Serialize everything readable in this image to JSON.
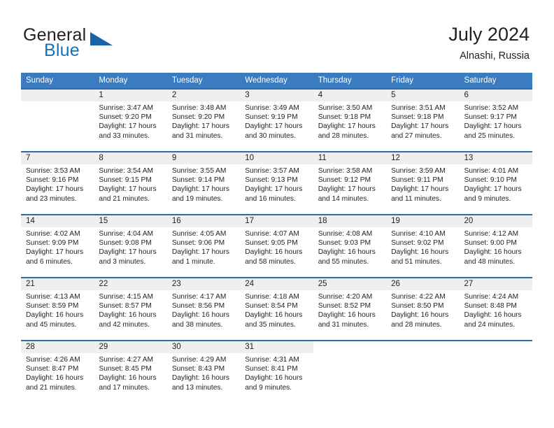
{
  "brand": {
    "word_one": "General",
    "word_two": "Blue",
    "accent_color": "#1573bb",
    "triangle_color": "#1565a8"
  },
  "header": {
    "title": "July 2024",
    "subtitle": "Alnashi, Russia",
    "header_bg": "#3a7cbf",
    "week_rule_color": "#2c6cae",
    "daynum_band_color": "#efefef"
  },
  "weekday_headers": [
    "Sunday",
    "Monday",
    "Tuesday",
    "Wednesday",
    "Thursday",
    "Friday",
    "Saturday"
  ],
  "weeks": [
    [
      {
        "day": "",
        "empty": true
      },
      {
        "day": "1",
        "sunrise": "Sunrise: 3:47 AM",
        "sunset": "Sunset: 9:20 PM",
        "daylight": "Daylight: 17 hours and 33 minutes."
      },
      {
        "day": "2",
        "sunrise": "Sunrise: 3:48 AM",
        "sunset": "Sunset: 9:20 PM",
        "daylight": "Daylight: 17 hours and 31 minutes."
      },
      {
        "day": "3",
        "sunrise": "Sunrise: 3:49 AM",
        "sunset": "Sunset: 9:19 PM",
        "daylight": "Daylight: 17 hours and 30 minutes."
      },
      {
        "day": "4",
        "sunrise": "Sunrise: 3:50 AM",
        "sunset": "Sunset: 9:18 PM",
        "daylight": "Daylight: 17 hours and 28 minutes."
      },
      {
        "day": "5",
        "sunrise": "Sunrise: 3:51 AM",
        "sunset": "Sunset: 9:18 PM",
        "daylight": "Daylight: 17 hours and 27 minutes."
      },
      {
        "day": "6",
        "sunrise": "Sunrise: 3:52 AM",
        "sunset": "Sunset: 9:17 PM",
        "daylight": "Daylight: 17 hours and 25 minutes."
      }
    ],
    [
      {
        "day": "7",
        "sunrise": "Sunrise: 3:53 AM",
        "sunset": "Sunset: 9:16 PM",
        "daylight": "Daylight: 17 hours and 23 minutes."
      },
      {
        "day": "8",
        "sunrise": "Sunrise: 3:54 AM",
        "sunset": "Sunset: 9:15 PM",
        "daylight": "Daylight: 17 hours and 21 minutes."
      },
      {
        "day": "9",
        "sunrise": "Sunrise: 3:55 AM",
        "sunset": "Sunset: 9:14 PM",
        "daylight": "Daylight: 17 hours and 19 minutes."
      },
      {
        "day": "10",
        "sunrise": "Sunrise: 3:57 AM",
        "sunset": "Sunset: 9:13 PM",
        "daylight": "Daylight: 17 hours and 16 minutes."
      },
      {
        "day": "11",
        "sunrise": "Sunrise: 3:58 AM",
        "sunset": "Sunset: 9:12 PM",
        "daylight": "Daylight: 17 hours and 14 minutes."
      },
      {
        "day": "12",
        "sunrise": "Sunrise: 3:59 AM",
        "sunset": "Sunset: 9:11 PM",
        "daylight": "Daylight: 17 hours and 11 minutes."
      },
      {
        "day": "13",
        "sunrise": "Sunrise: 4:01 AM",
        "sunset": "Sunset: 9:10 PM",
        "daylight": "Daylight: 17 hours and 9 minutes."
      }
    ],
    [
      {
        "day": "14",
        "sunrise": "Sunrise: 4:02 AM",
        "sunset": "Sunset: 9:09 PM",
        "daylight": "Daylight: 17 hours and 6 minutes."
      },
      {
        "day": "15",
        "sunrise": "Sunrise: 4:04 AM",
        "sunset": "Sunset: 9:08 PM",
        "daylight": "Daylight: 17 hours and 3 minutes."
      },
      {
        "day": "16",
        "sunrise": "Sunrise: 4:05 AM",
        "sunset": "Sunset: 9:06 PM",
        "daylight": "Daylight: 17 hours and 1 minute."
      },
      {
        "day": "17",
        "sunrise": "Sunrise: 4:07 AM",
        "sunset": "Sunset: 9:05 PM",
        "daylight": "Daylight: 16 hours and 58 minutes."
      },
      {
        "day": "18",
        "sunrise": "Sunrise: 4:08 AM",
        "sunset": "Sunset: 9:03 PM",
        "daylight": "Daylight: 16 hours and 55 minutes."
      },
      {
        "day": "19",
        "sunrise": "Sunrise: 4:10 AM",
        "sunset": "Sunset: 9:02 PM",
        "daylight": "Daylight: 16 hours and 51 minutes."
      },
      {
        "day": "20",
        "sunrise": "Sunrise: 4:12 AM",
        "sunset": "Sunset: 9:00 PM",
        "daylight": "Daylight: 16 hours and 48 minutes."
      }
    ],
    [
      {
        "day": "21",
        "sunrise": "Sunrise: 4:13 AM",
        "sunset": "Sunset: 8:59 PM",
        "daylight": "Daylight: 16 hours and 45 minutes."
      },
      {
        "day": "22",
        "sunrise": "Sunrise: 4:15 AM",
        "sunset": "Sunset: 8:57 PM",
        "daylight": "Daylight: 16 hours and 42 minutes."
      },
      {
        "day": "23",
        "sunrise": "Sunrise: 4:17 AM",
        "sunset": "Sunset: 8:56 PM",
        "daylight": "Daylight: 16 hours and 38 minutes."
      },
      {
        "day": "24",
        "sunrise": "Sunrise: 4:18 AM",
        "sunset": "Sunset: 8:54 PM",
        "daylight": "Daylight: 16 hours and 35 minutes."
      },
      {
        "day": "25",
        "sunrise": "Sunrise: 4:20 AM",
        "sunset": "Sunset: 8:52 PM",
        "daylight": "Daylight: 16 hours and 31 minutes."
      },
      {
        "day": "26",
        "sunrise": "Sunrise: 4:22 AM",
        "sunset": "Sunset: 8:50 PM",
        "daylight": "Daylight: 16 hours and 28 minutes."
      },
      {
        "day": "27",
        "sunrise": "Sunrise: 4:24 AM",
        "sunset": "Sunset: 8:48 PM",
        "daylight": "Daylight: 16 hours and 24 minutes."
      }
    ],
    [
      {
        "day": "28",
        "sunrise": "Sunrise: 4:26 AM",
        "sunset": "Sunset: 8:47 PM",
        "daylight": "Daylight: 16 hours and 21 minutes."
      },
      {
        "day": "29",
        "sunrise": "Sunrise: 4:27 AM",
        "sunset": "Sunset: 8:45 PM",
        "daylight": "Daylight: 16 hours and 17 minutes."
      },
      {
        "day": "30",
        "sunrise": "Sunrise: 4:29 AM",
        "sunset": "Sunset: 8:43 PM",
        "daylight": "Daylight: 16 hours and 13 minutes."
      },
      {
        "day": "31",
        "sunrise": "Sunrise: 4:31 AM",
        "sunset": "Sunset: 8:41 PM",
        "daylight": "Daylight: 16 hours and 9 minutes."
      },
      {
        "day": "",
        "empty": true,
        "blank": true
      },
      {
        "day": "",
        "empty": true,
        "blank": true
      },
      {
        "day": "",
        "empty": true,
        "blank": true
      }
    ]
  ]
}
